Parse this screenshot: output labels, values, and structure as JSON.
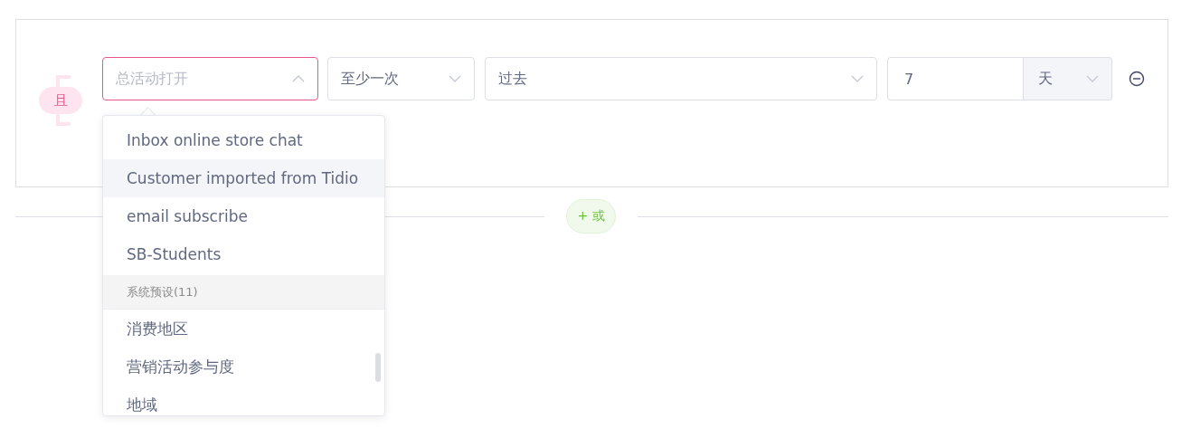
{
  "condition_group": {
    "connector": "且",
    "rule": {
      "field_select": {
        "placeholder": "总活动打开",
        "expanded": true
      },
      "frequency_select": {
        "value": "至少一次"
      },
      "time_select": {
        "value": "过去"
      },
      "amount_input": {
        "value": "7"
      },
      "unit_select": {
        "value": "天"
      }
    },
    "dropdown": {
      "options": [
        {
          "kind": "option",
          "label": "Inbox online store chat",
          "highlighted": false
        },
        {
          "kind": "option",
          "label": "Customer imported from Tidio",
          "highlighted": true
        },
        {
          "kind": "option",
          "label": "email subscribe",
          "highlighted": false
        },
        {
          "kind": "option",
          "label": "SB-Students",
          "highlighted": false
        },
        {
          "kind": "group",
          "label": "系统预设(11)",
          "highlighted": false
        },
        {
          "kind": "option",
          "label": "消费地区",
          "highlighted": false
        },
        {
          "kind": "option",
          "label": "营销活动参与度",
          "highlighted": false
        },
        {
          "kind": "option",
          "label": "地域",
          "highlighted": false
        }
      ]
    }
  },
  "add_or_button": {
    "label": "+ 或"
  }
}
